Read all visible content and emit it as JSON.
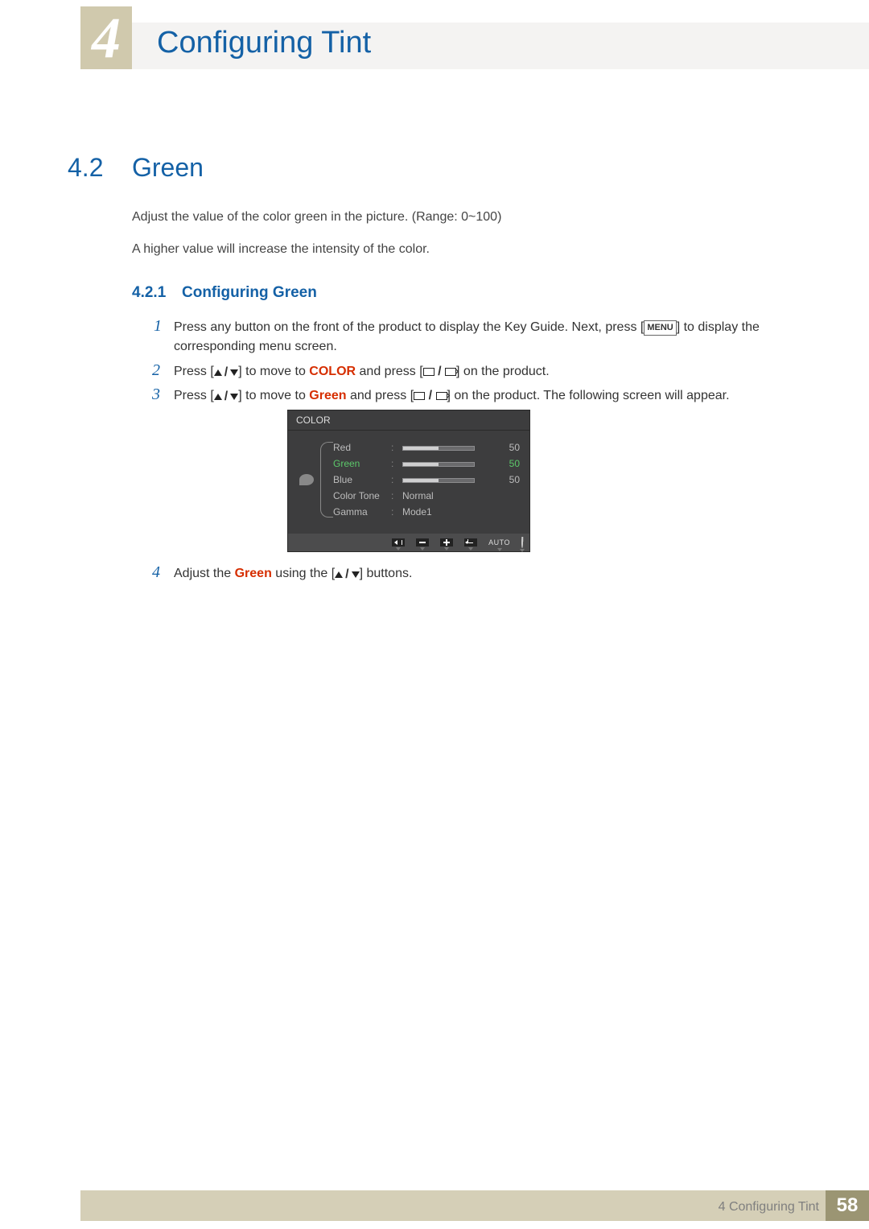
{
  "header": {
    "chapter_number": "4",
    "chapter_title": "Configuring Tint"
  },
  "section": {
    "number": "4.2",
    "title": "Green",
    "intro_1": "Adjust the value of the color green in the picture. (Range: 0~100)",
    "intro_2": "A higher value will increase the intensity of the color."
  },
  "subsection": {
    "number": "4.2.1",
    "title": "Configuring Green"
  },
  "steps": {
    "s1_num": "1",
    "s1_a": "Press any button on the front of the product to display the Key Guide. Next, press [",
    "s1_menu": "MENU",
    "s1_b": "] to display the corresponding menu screen.",
    "s2_num": "2",
    "s2_a": "Press [",
    "s2_b": "] to move to ",
    "s2_kw": "COLOR",
    "s2_c": " and press [",
    "s2_d": "] on the product.",
    "s3_num": "3",
    "s3_a": "Press [",
    "s3_b": "] to move to ",
    "s3_kw": "Green",
    "s3_c": " and press [",
    "s3_d": "] on the product. The following screen will appear.",
    "s4_num": "4",
    "s4_a": "Adjust the ",
    "s4_kw": "Green",
    "s4_b": " using the [",
    "s4_c": "] buttons."
  },
  "osd": {
    "title": "COLOR",
    "rows": [
      {
        "label": "Red",
        "value_type": "bar",
        "bar_fill": 50,
        "num": "50",
        "selected": false
      },
      {
        "label": "Green",
        "value_type": "bar",
        "bar_fill": 50,
        "num": "50",
        "selected": true
      },
      {
        "label": "Blue",
        "value_type": "bar",
        "bar_fill": 50,
        "num": "50",
        "selected": false
      },
      {
        "label": "Color Tone",
        "value_type": "text",
        "text": "Normal",
        "selected": false
      },
      {
        "label": "Gamma",
        "value_type": "text",
        "text": "Mode1",
        "selected": false
      }
    ],
    "footer_auto": "AUTO"
  },
  "footer": {
    "chapter_ref": "4 Configuring Tint",
    "page": "58"
  }
}
